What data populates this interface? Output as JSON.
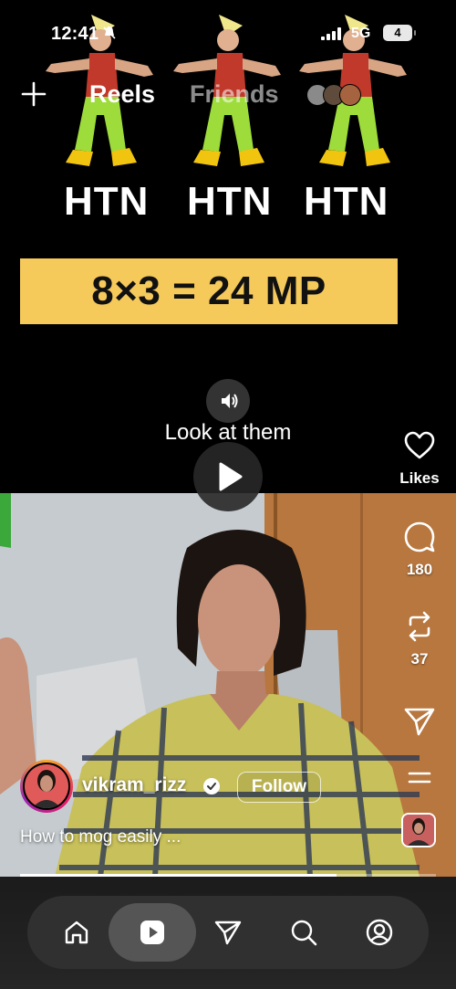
{
  "status_bar": {
    "time": "12:41",
    "network": "5G",
    "battery": "4"
  },
  "header": {
    "tab_reels": "Reels",
    "tab_friends": "Friends"
  },
  "meme": {
    "labels": [
      "HTN",
      "HTN",
      "HTN"
    ],
    "equation": "8×3 = 24 MP"
  },
  "overlay": {
    "caption": "Look at them"
  },
  "actions": {
    "likes_label": "Likes",
    "comments_count": "180",
    "reposts_count": "37"
  },
  "author": {
    "username": "vikram_rizz",
    "follow_label": "Follow",
    "title": "How to mog easily ..."
  },
  "progress": {
    "fraction": 0.76
  },
  "nav": {
    "items": [
      "home",
      "reels",
      "messages",
      "search",
      "profile"
    ],
    "active": "reels"
  },
  "colors": {
    "accent_yellow": "#f5c95a",
    "background": "#000000",
    "nav_bg": "#303030"
  }
}
